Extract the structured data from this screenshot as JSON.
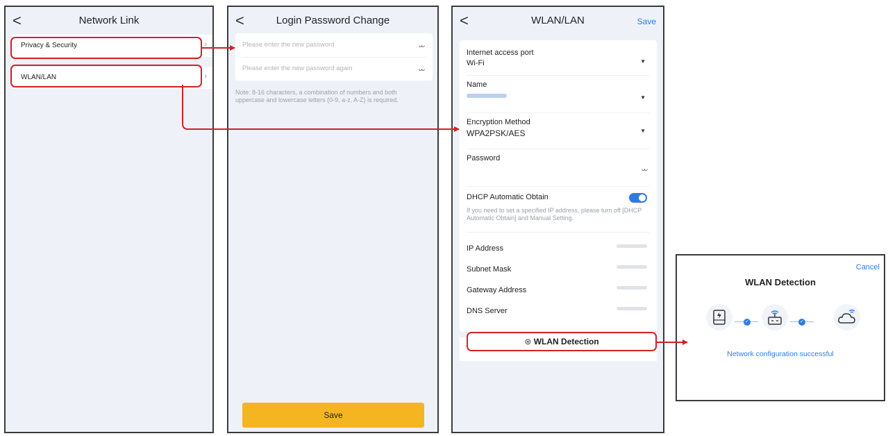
{
  "colors": {
    "accent": "#2f7be0",
    "highlight": "#d32027",
    "save_button": "#f5b520",
    "screen_bg": "#eef2f8"
  },
  "icons": {
    "back": "chevron-left-icon",
    "chevron": "chevron-right-icon",
    "eye_closed": "eye-closed-icon",
    "dropdown": "caret-down-icon",
    "detect": "search-wifi-icon",
    "inverter": "inverter-icon",
    "router": "router-icon",
    "cloud": "cloud-icon",
    "check": "check-icon"
  },
  "network_link": {
    "back_glyph": "<",
    "title": "Network Link",
    "items": [
      {
        "label": "Privacy & Security",
        "chevron": "›"
      },
      {
        "label": "WLAN/LAN",
        "chevron": "›"
      }
    ]
  },
  "password_change": {
    "back_glyph": "<",
    "title": "Login Password Change",
    "new_password_placeholder": "Please enter the new password",
    "confirm_password_placeholder": "Please enter the new password again",
    "eye_glyph": "ᴗᴗ",
    "note": "Note: 8-16 characters, a combination of numbers and both uppercase and lowercase letters (0-9, a-z, A-Z) is required.",
    "save_label": "Save"
  },
  "wlan_lan": {
    "back_glyph": "<",
    "title": "WLAN/LAN",
    "save_label": "Save",
    "dropdown_glyph": "▼",
    "access_port": {
      "label": "Internet access port",
      "value": "Wi-Fi"
    },
    "name": {
      "label": "Name"
    },
    "encryption": {
      "label": "Encryption Method",
      "value": "WPA2PSK/AES"
    },
    "password": {
      "label": "Password",
      "eye_glyph": "ᴗᴗ"
    },
    "dhcp": {
      "label": "DHCP Automatic Obtain",
      "enabled": true,
      "note": "If you need to set a specified IP address, please turn off [DHCP Automatic Obtain] and Manual Setting."
    },
    "ip_rows": [
      {
        "label": "IP Address"
      },
      {
        "label": "Subnet Mask"
      },
      {
        "label": "Gateway Address"
      },
      {
        "label": "DNS Server"
      }
    ],
    "detect_label": "WLAN Detection",
    "detect_glyph": "⊛"
  },
  "wlan_detection_dialog": {
    "cancel_label": "Cancel",
    "title": "WLAN Detection",
    "status": "Network configuration successful",
    "check_glyph": "✓"
  }
}
